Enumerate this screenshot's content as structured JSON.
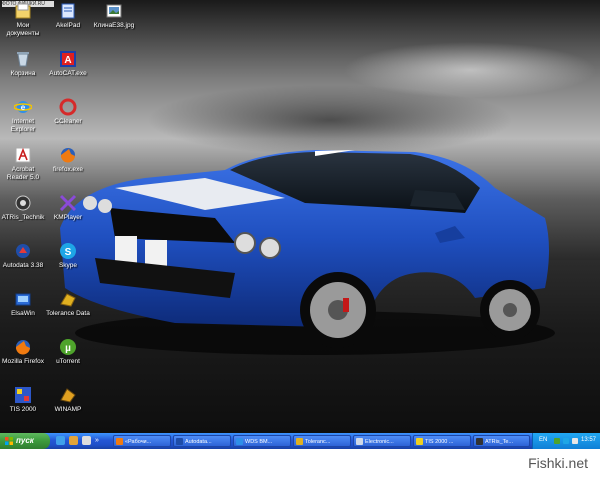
{
  "stamp": "ФОТО ФИШКИ.RU",
  "desktop_icons": [
    {
      "name": "Мои",
      "name2": "документы",
      "icon": "my-documents-icon"
    },
    {
      "name": "AkelPad",
      "name2": "",
      "icon": "akelpad-icon"
    },
    {
      "name": "КлинаE38.jpg",
      "name2": "",
      "icon": "jpg-file-icon"
    },
    {
      "name": "Корзина",
      "name2": "",
      "icon": "recycle-bin-icon"
    },
    {
      "name": "AutoCAT.exe",
      "name2": "",
      "icon": "autocat-icon"
    },
    {
      "name": "Internet",
      "name2": "Explorer",
      "icon": "internet-explorer-icon"
    },
    {
      "name": "CCleaner",
      "name2": "",
      "icon": "ccleaner-icon"
    },
    {
      "name": "Acrobat",
      "name2": "Reader 5.0",
      "icon": "acrobat-reader-icon"
    },
    {
      "name": "firefox.exe",
      "name2": "",
      "icon": "firefox-icon"
    },
    {
      "name": "ATRis_Technik",
      "name2": "",
      "icon": "atris-technik-icon"
    },
    {
      "name": "KMPlayer",
      "name2": "",
      "icon": "kmplayer-icon"
    },
    {
      "name": "Autodata 3.38",
      "name2": "",
      "icon": "autodata-icon"
    },
    {
      "name": "Skype",
      "name2": "",
      "icon": "skype-icon"
    },
    {
      "name": "ElsaWin",
      "name2": "",
      "icon": "elsawin-icon"
    },
    {
      "name": "Tolerance Data",
      "name2": "",
      "icon": "tolerance-data-icon"
    },
    {
      "name": "Mozilla Firefox",
      "name2": "",
      "icon": "mozilla-firefox-icon"
    },
    {
      "name": "uTorrent",
      "name2": "",
      "icon": "utorrent-icon"
    },
    {
      "name": "TIS 2000",
      "name2": "",
      "icon": "tis-2000-icon"
    },
    {
      "name": "WINAMP",
      "name2": "",
      "icon": "winamp-icon"
    }
  ],
  "taskbar": {
    "start_label": "пуск",
    "tasks": [
      {
        "label": "«Рабочи...",
        "icon": "firefox-icon"
      },
      {
        "label": "Autodata...",
        "icon": "autodata-icon"
      },
      {
        "label": "WDS BM...",
        "icon": "internet-explorer-icon"
      },
      {
        "label": "Toleranc...",
        "icon": "tolerance-data-icon"
      },
      {
        "label": "Electronic...",
        "icon": "window-icon"
      },
      {
        "label": "TIS 2000 ...",
        "icon": "tis-2000-icon"
      },
      {
        "label": "ATRis_Te...",
        "icon": "atris-technik-icon"
      }
    ],
    "language": "EN",
    "clock": "13:57"
  },
  "watermark": "Fishki.net",
  "colors": {
    "taskbar": "#2457d5",
    "start": "#3c9a3c",
    "tray": "#0f7fd6",
    "car_body": "#1f4fbf"
  }
}
